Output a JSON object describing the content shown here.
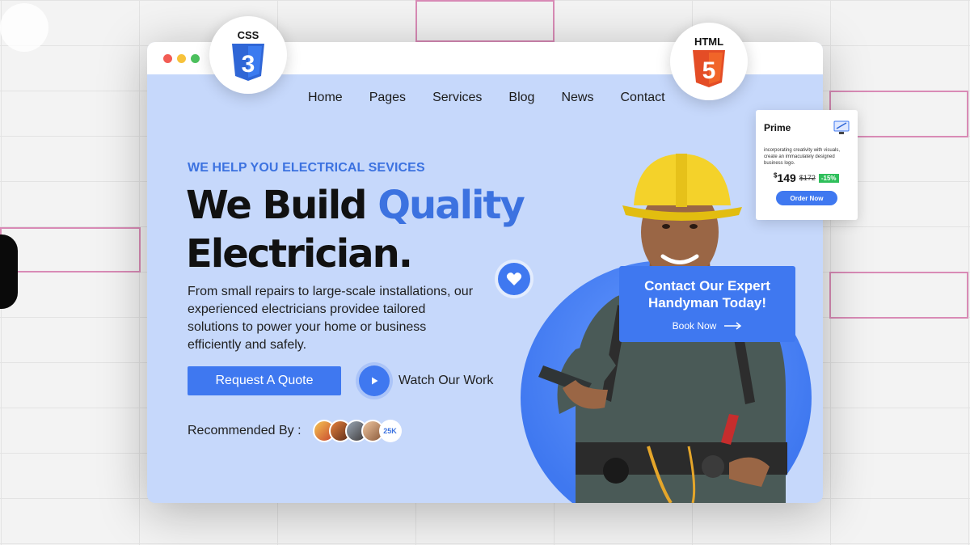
{
  "nav": [
    "Home",
    "Pages",
    "Services",
    "Blog",
    "News",
    "Contact"
  ],
  "hero": {
    "eyebrow": "WE HELP YOU ELECTRICAL SEVICES",
    "headline_1": "We Build ",
    "headline_accent": "Quality",
    "headline_2": "Electrician.",
    "description": "From small repairs to large-scale installations, our experienced electricians providee tailored solutions to power your home or business efficiently and safely.",
    "quote_button": "Request A Quote",
    "watch_label": "Watch Our Work",
    "recommended_label": "Recommended By :",
    "recommended_count": "25K"
  },
  "contact_card": {
    "title": "Contact Our Expert Handyman Today!",
    "link": "Book Now"
  },
  "badges": {
    "css": "CSS",
    "html": "HTML",
    "css_digit": "3",
    "html_digit": "5"
  },
  "pricing": {
    "title": "Prime",
    "description": "incorporating creativity with visuals, create an immaculately designed business logo.",
    "currency": "$",
    "price": "149",
    "old_price": "$172",
    "discount": "-15%",
    "order_button": "Order Now"
  },
  "icons": {
    "play": "play-icon",
    "heart": "heart-icon",
    "arrow": "arrow-right-icon",
    "design": "design-icon"
  },
  "colors": {
    "accent": "#3f78f0",
    "hero_bg": "#c6d8fb",
    "css_blue": "#2f66d6",
    "html_orange": "#ef5a24",
    "discount_green": "#2fbf5b"
  }
}
